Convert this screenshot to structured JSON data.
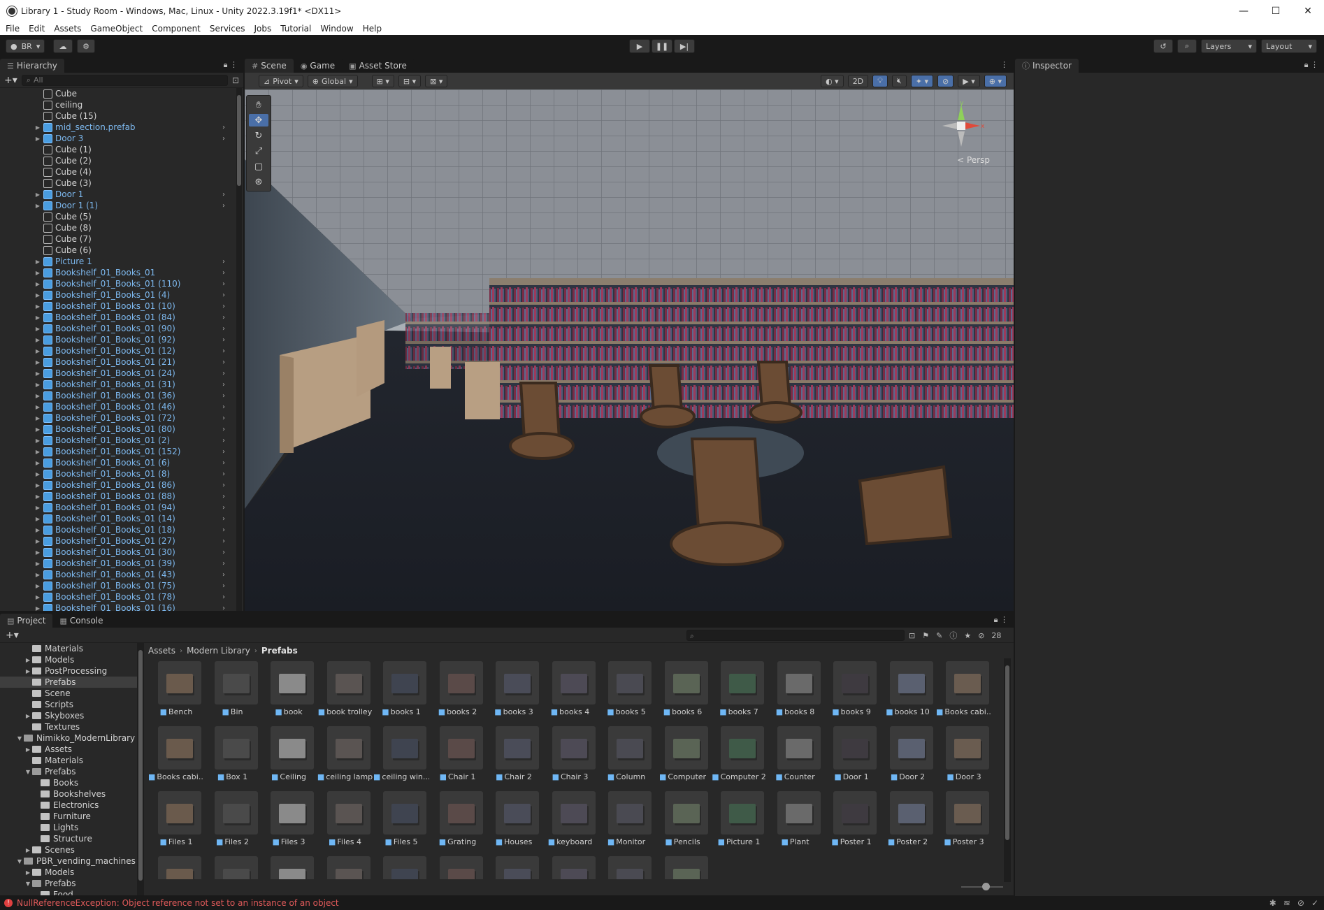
{
  "window": {
    "title": "Library 1 - Study Room - Windows, Mac, Linux - Unity 2022.3.19f1* <DX11>",
    "minimize": "—",
    "maximize": "☐",
    "close": "✕"
  },
  "menu": [
    "File",
    "Edit",
    "Assets",
    "GameObject",
    "Component",
    "Services",
    "Jobs",
    "Tutorial",
    "Window",
    "Help"
  ],
  "toolbar": {
    "account": "BR",
    "layers": "Layers",
    "layout": "Layout"
  },
  "hierarchy": {
    "tab": "Hierarchy",
    "search_placeholder": "All",
    "items": [
      {
        "label": "Cube",
        "prefab": false
      },
      {
        "label": "ceiling",
        "prefab": false
      },
      {
        "label": "Cube (15)",
        "prefab": false
      },
      {
        "label": "mid_section.prefab",
        "prefab": true
      },
      {
        "label": "Door 3",
        "prefab": true
      },
      {
        "label": "Cube (1)",
        "prefab": false
      },
      {
        "label": "Cube (2)",
        "prefab": false
      },
      {
        "label": "Cube (4)",
        "prefab": false
      },
      {
        "label": "Cube (3)",
        "prefab": false
      },
      {
        "label": "Door 1",
        "prefab": true
      },
      {
        "label": "Door 1 (1)",
        "prefab": true
      },
      {
        "label": "Cube (5)",
        "prefab": false
      },
      {
        "label": "Cube (8)",
        "prefab": false
      },
      {
        "label": "Cube (7)",
        "prefab": false
      },
      {
        "label": "Cube (6)",
        "prefab": false
      },
      {
        "label": "Picture 1",
        "prefab": true
      },
      {
        "label": "Bookshelf_01_Books_01",
        "prefab": true
      },
      {
        "label": "Bookshelf_01_Books_01 (110)",
        "prefab": true
      },
      {
        "label": "Bookshelf_01_Books_01 (4)",
        "prefab": true
      },
      {
        "label": "Bookshelf_01_Books_01 (10)",
        "prefab": true
      },
      {
        "label": "Bookshelf_01_Books_01 (84)",
        "prefab": true
      },
      {
        "label": "Bookshelf_01_Books_01 (90)",
        "prefab": true
      },
      {
        "label": "Bookshelf_01_Books_01 (92)",
        "prefab": true
      },
      {
        "label": "Bookshelf_01_Books_01 (12)",
        "prefab": true
      },
      {
        "label": "Bookshelf_01_Books_01 (21)",
        "prefab": true
      },
      {
        "label": "Bookshelf_01_Books_01 (24)",
        "prefab": true
      },
      {
        "label": "Bookshelf_01_Books_01 (31)",
        "prefab": true
      },
      {
        "label": "Bookshelf_01_Books_01 (36)",
        "prefab": true
      },
      {
        "label": "Bookshelf_01_Books_01 (46)",
        "prefab": true
      },
      {
        "label": "Bookshelf_01_Books_01 (72)",
        "prefab": true
      },
      {
        "label": "Bookshelf_01_Books_01 (80)",
        "prefab": true
      },
      {
        "label": "Bookshelf_01_Books_01 (2)",
        "prefab": true
      },
      {
        "label": "Bookshelf_01_Books_01 (152)",
        "prefab": true
      },
      {
        "label": "Bookshelf_01_Books_01 (6)",
        "prefab": true
      },
      {
        "label": "Bookshelf_01_Books_01 (8)",
        "prefab": true
      },
      {
        "label": "Bookshelf_01_Books_01 (86)",
        "prefab": true
      },
      {
        "label": "Bookshelf_01_Books_01 (88)",
        "prefab": true
      },
      {
        "label": "Bookshelf_01_Books_01 (94)",
        "prefab": true
      },
      {
        "label": "Bookshelf_01_Books_01 (14)",
        "prefab": true
      },
      {
        "label": "Bookshelf_01_Books_01 (18)",
        "prefab": true
      },
      {
        "label": "Bookshelf_01_Books_01 (27)",
        "prefab": true
      },
      {
        "label": "Bookshelf_01_Books_01 (30)",
        "prefab": true
      },
      {
        "label": "Bookshelf_01_Books_01 (39)",
        "prefab": true
      },
      {
        "label": "Bookshelf_01_Books_01 (43)",
        "prefab": true
      },
      {
        "label": "Bookshelf_01_Books_01 (75)",
        "prefab": true
      },
      {
        "label": "Bookshelf_01_Books_01 (78)",
        "prefab": true
      },
      {
        "label": "Bookshelf_01_Books_01 (16)",
        "prefab": true
      }
    ]
  },
  "scene": {
    "tabs": [
      "Scene",
      "Game",
      "Asset Store"
    ],
    "pivot": "Pivot",
    "global": "Global",
    "mode_2d": "2D",
    "persp": "< Persp",
    "axis_y": "y",
    "axis_x": "x"
  },
  "inspector": {
    "tab": "Inspector"
  },
  "project": {
    "tabs": [
      "Project",
      "Console"
    ],
    "hidden_count": "28",
    "breadcrumb": [
      "Assets",
      "Modern Library",
      "Prefabs"
    ],
    "tree": [
      {
        "label": "Materials",
        "depth": 2,
        "arrow": "",
        "open": false,
        "selected": false
      },
      {
        "label": "Models",
        "depth": 2,
        "arrow": "▶",
        "open": false,
        "selected": false
      },
      {
        "label": "PostProcessing",
        "depth": 2,
        "arrow": "▶",
        "open": false,
        "selected": false
      },
      {
        "label": "Prefabs",
        "depth": 2,
        "arrow": "",
        "open": false,
        "selected": true
      },
      {
        "label": "Scene",
        "depth": 2,
        "arrow": "",
        "open": false,
        "selected": false
      },
      {
        "label": "Scripts",
        "depth": 2,
        "arrow": "",
        "open": false,
        "selected": false
      },
      {
        "label": "Skyboxes",
        "depth": 2,
        "arrow": "▶",
        "open": false,
        "selected": false
      },
      {
        "label": "Textures",
        "depth": 2,
        "arrow": "",
        "open": false,
        "selected": false
      },
      {
        "label": "Nimikko_ModernLibrary",
        "depth": 1,
        "arrow": "▼",
        "open": true,
        "selected": false
      },
      {
        "label": "Assets",
        "depth": 2,
        "arrow": "▶",
        "open": false,
        "selected": false
      },
      {
        "label": "Materials",
        "depth": 2,
        "arrow": "",
        "open": false,
        "selected": false
      },
      {
        "label": "Prefabs",
        "depth": 2,
        "arrow": "▼",
        "open": true,
        "selected": false
      },
      {
        "label": "Books",
        "depth": 3,
        "arrow": "",
        "open": false,
        "selected": false
      },
      {
        "label": "Bookshelves",
        "depth": 3,
        "arrow": "",
        "open": false,
        "selected": false
      },
      {
        "label": "Electronics",
        "depth": 3,
        "arrow": "",
        "open": false,
        "selected": false
      },
      {
        "label": "Furniture",
        "depth": 3,
        "arrow": "",
        "open": false,
        "selected": false
      },
      {
        "label": "Lights",
        "depth": 3,
        "arrow": "",
        "open": false,
        "selected": false
      },
      {
        "label": "Structure",
        "depth": 3,
        "arrow": "",
        "open": false,
        "selected": false
      },
      {
        "label": "Scenes",
        "depth": 2,
        "arrow": "▶",
        "open": false,
        "selected": false
      },
      {
        "label": "PBR_vending_machines",
        "depth": 1,
        "arrow": "▼",
        "open": true,
        "selected": false
      },
      {
        "label": "Models",
        "depth": 2,
        "arrow": "▶",
        "open": false,
        "selected": false
      },
      {
        "label": "Prefabs",
        "depth": 2,
        "arrow": "▼",
        "open": true,
        "selected": false
      },
      {
        "label": "Food",
        "depth": 3,
        "arrow": "",
        "open": false,
        "selected": false
      }
    ],
    "assets": [
      [
        "Bench",
        "Bin",
        "book",
        "book trolley",
        "books 1",
        "books 2",
        "books 3",
        "books 4",
        "books 5",
        "books 6",
        "books 7",
        "books 8",
        "books 9",
        "books 10",
        "Books cabi..."
      ],
      [
        "Books cabi...",
        "Box 1",
        "Ceiling",
        "ceiling lamp",
        "ceiling win...",
        "Chair 1",
        "Chair 2",
        "Chair 3",
        "Column",
        "Computer",
        "Computer 2",
        "Counter",
        "Door 1",
        "Door 2",
        "Door 3"
      ],
      [
        "Files 1",
        "Files 2",
        "Files 3",
        "Files 4",
        "Files 5",
        "Grating",
        "Houses",
        "keyboard",
        "Monitor",
        "Pencils",
        "Picture 1",
        "Plant",
        "Poster 1",
        "Poster 2",
        "Poster 3"
      ],
      [
        "",
        "",
        "",
        "",
        "",
        "",
        "",
        "",
        "",
        ""
      ]
    ]
  },
  "status": {
    "error": "NullReferenceException: Object reference not set to an instance of an object"
  }
}
